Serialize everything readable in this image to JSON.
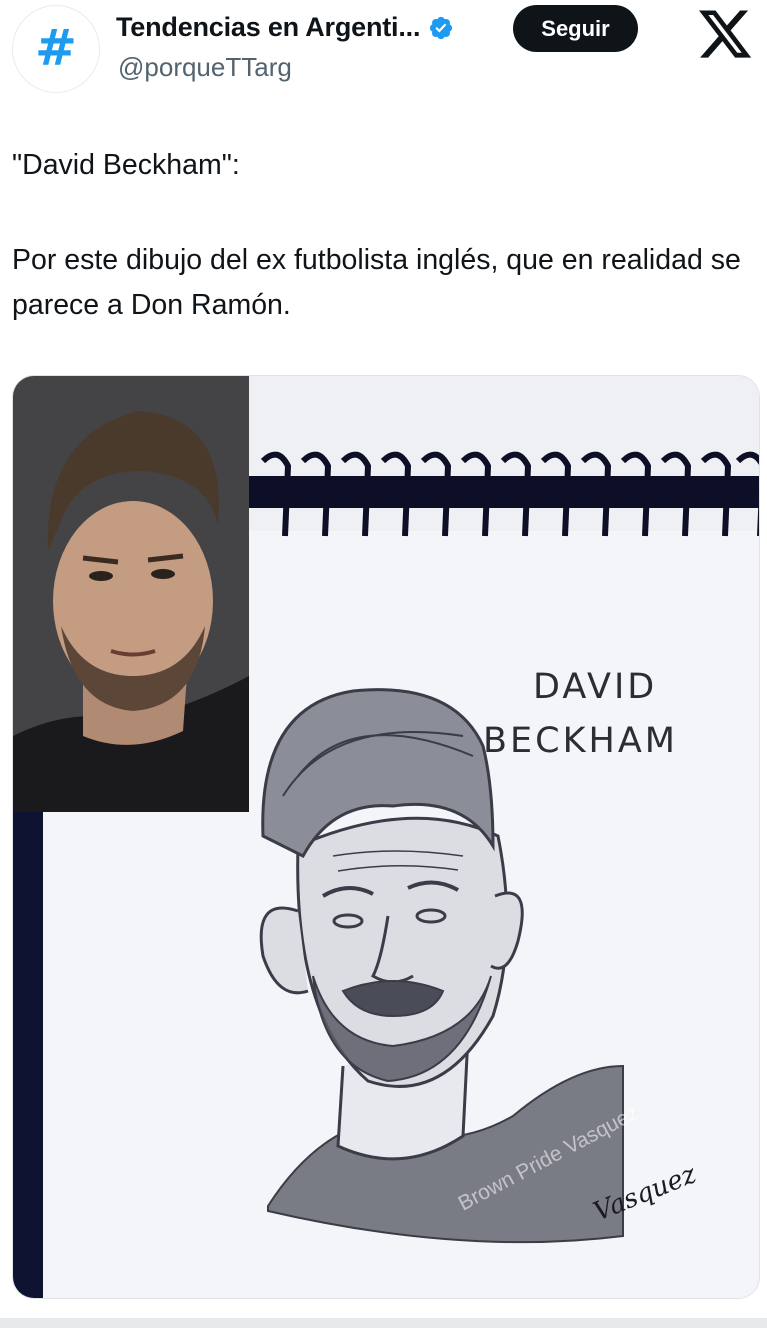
{
  "account": {
    "display_name": "Tendencias en Argenti...",
    "handle": "@porqueTTarg",
    "avatar_icon": "hashtag-icon",
    "avatar_glyph": "#",
    "verified_icon": "verified-badge-icon",
    "accent_color": "#1d9bf0"
  },
  "header": {
    "follow_label": "Seguir",
    "logo_icon": "x-logo-icon"
  },
  "tweet": {
    "line1": "\"David Beckham\":",
    "line2": "Por este dibujo del ex futbolista inglés, que en realidad se parece a Don Ramón."
  },
  "media": {
    "drawing_label_line1": "DAVID",
    "drawing_label_line2": "BECKHAM",
    "watermark": "Brown Pride Vasquez",
    "signature": "Vasquez"
  }
}
